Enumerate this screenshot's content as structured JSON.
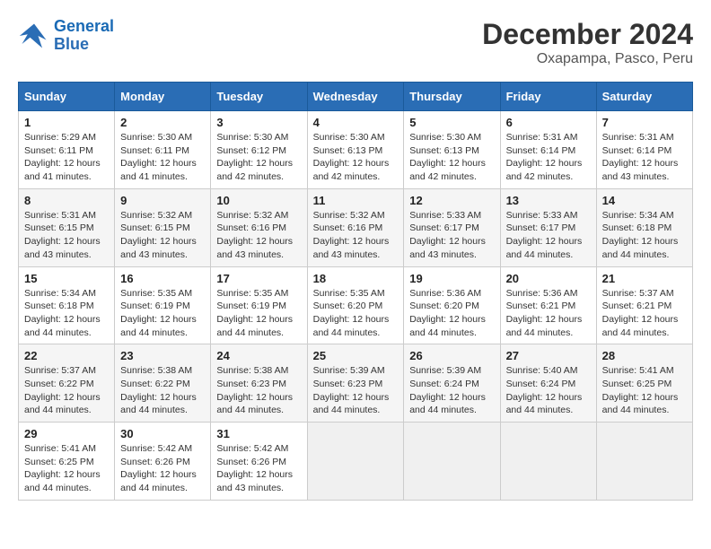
{
  "logo": {
    "line1": "General",
    "line2": "Blue"
  },
  "title": "December 2024",
  "subtitle": "Oxapampa, Pasco, Peru",
  "weekdays": [
    "Sunday",
    "Monday",
    "Tuesday",
    "Wednesday",
    "Thursday",
    "Friday",
    "Saturday"
  ],
  "weeks": [
    [
      {
        "day": "1",
        "info": "Sunrise: 5:29 AM\nSunset: 6:11 PM\nDaylight: 12 hours and 41 minutes."
      },
      {
        "day": "2",
        "info": "Sunrise: 5:30 AM\nSunset: 6:11 PM\nDaylight: 12 hours and 41 minutes."
      },
      {
        "day": "3",
        "info": "Sunrise: 5:30 AM\nSunset: 6:12 PM\nDaylight: 12 hours and 42 minutes."
      },
      {
        "day": "4",
        "info": "Sunrise: 5:30 AM\nSunset: 6:13 PM\nDaylight: 12 hours and 42 minutes."
      },
      {
        "day": "5",
        "info": "Sunrise: 5:30 AM\nSunset: 6:13 PM\nDaylight: 12 hours and 42 minutes."
      },
      {
        "day": "6",
        "info": "Sunrise: 5:31 AM\nSunset: 6:14 PM\nDaylight: 12 hours and 42 minutes."
      },
      {
        "day": "7",
        "info": "Sunrise: 5:31 AM\nSunset: 6:14 PM\nDaylight: 12 hours and 43 minutes."
      }
    ],
    [
      {
        "day": "8",
        "info": "Sunrise: 5:31 AM\nSunset: 6:15 PM\nDaylight: 12 hours and 43 minutes."
      },
      {
        "day": "9",
        "info": "Sunrise: 5:32 AM\nSunset: 6:15 PM\nDaylight: 12 hours and 43 minutes."
      },
      {
        "day": "10",
        "info": "Sunrise: 5:32 AM\nSunset: 6:16 PM\nDaylight: 12 hours and 43 minutes."
      },
      {
        "day": "11",
        "info": "Sunrise: 5:32 AM\nSunset: 6:16 PM\nDaylight: 12 hours and 43 minutes."
      },
      {
        "day": "12",
        "info": "Sunrise: 5:33 AM\nSunset: 6:17 PM\nDaylight: 12 hours and 43 minutes."
      },
      {
        "day": "13",
        "info": "Sunrise: 5:33 AM\nSunset: 6:17 PM\nDaylight: 12 hours and 44 minutes."
      },
      {
        "day": "14",
        "info": "Sunrise: 5:34 AM\nSunset: 6:18 PM\nDaylight: 12 hours and 44 minutes."
      }
    ],
    [
      {
        "day": "15",
        "info": "Sunrise: 5:34 AM\nSunset: 6:18 PM\nDaylight: 12 hours and 44 minutes."
      },
      {
        "day": "16",
        "info": "Sunrise: 5:35 AM\nSunset: 6:19 PM\nDaylight: 12 hours and 44 minutes."
      },
      {
        "day": "17",
        "info": "Sunrise: 5:35 AM\nSunset: 6:19 PM\nDaylight: 12 hours and 44 minutes."
      },
      {
        "day": "18",
        "info": "Sunrise: 5:35 AM\nSunset: 6:20 PM\nDaylight: 12 hours and 44 minutes."
      },
      {
        "day": "19",
        "info": "Sunrise: 5:36 AM\nSunset: 6:20 PM\nDaylight: 12 hours and 44 minutes."
      },
      {
        "day": "20",
        "info": "Sunrise: 5:36 AM\nSunset: 6:21 PM\nDaylight: 12 hours and 44 minutes."
      },
      {
        "day": "21",
        "info": "Sunrise: 5:37 AM\nSunset: 6:21 PM\nDaylight: 12 hours and 44 minutes."
      }
    ],
    [
      {
        "day": "22",
        "info": "Sunrise: 5:37 AM\nSunset: 6:22 PM\nDaylight: 12 hours and 44 minutes."
      },
      {
        "day": "23",
        "info": "Sunrise: 5:38 AM\nSunset: 6:22 PM\nDaylight: 12 hours and 44 minutes."
      },
      {
        "day": "24",
        "info": "Sunrise: 5:38 AM\nSunset: 6:23 PM\nDaylight: 12 hours and 44 minutes."
      },
      {
        "day": "25",
        "info": "Sunrise: 5:39 AM\nSunset: 6:23 PM\nDaylight: 12 hours and 44 minutes."
      },
      {
        "day": "26",
        "info": "Sunrise: 5:39 AM\nSunset: 6:24 PM\nDaylight: 12 hours and 44 minutes."
      },
      {
        "day": "27",
        "info": "Sunrise: 5:40 AM\nSunset: 6:24 PM\nDaylight: 12 hours and 44 minutes."
      },
      {
        "day": "28",
        "info": "Sunrise: 5:41 AM\nSunset: 6:25 PM\nDaylight: 12 hours and 44 minutes."
      }
    ],
    [
      {
        "day": "29",
        "info": "Sunrise: 5:41 AM\nSunset: 6:25 PM\nDaylight: 12 hours and 44 minutes."
      },
      {
        "day": "30",
        "info": "Sunrise: 5:42 AM\nSunset: 6:26 PM\nDaylight: 12 hours and 44 minutes."
      },
      {
        "day": "31",
        "info": "Sunrise: 5:42 AM\nSunset: 6:26 PM\nDaylight: 12 hours and 43 minutes."
      },
      {
        "day": "",
        "info": ""
      },
      {
        "day": "",
        "info": ""
      },
      {
        "day": "",
        "info": ""
      },
      {
        "day": "",
        "info": ""
      }
    ]
  ]
}
